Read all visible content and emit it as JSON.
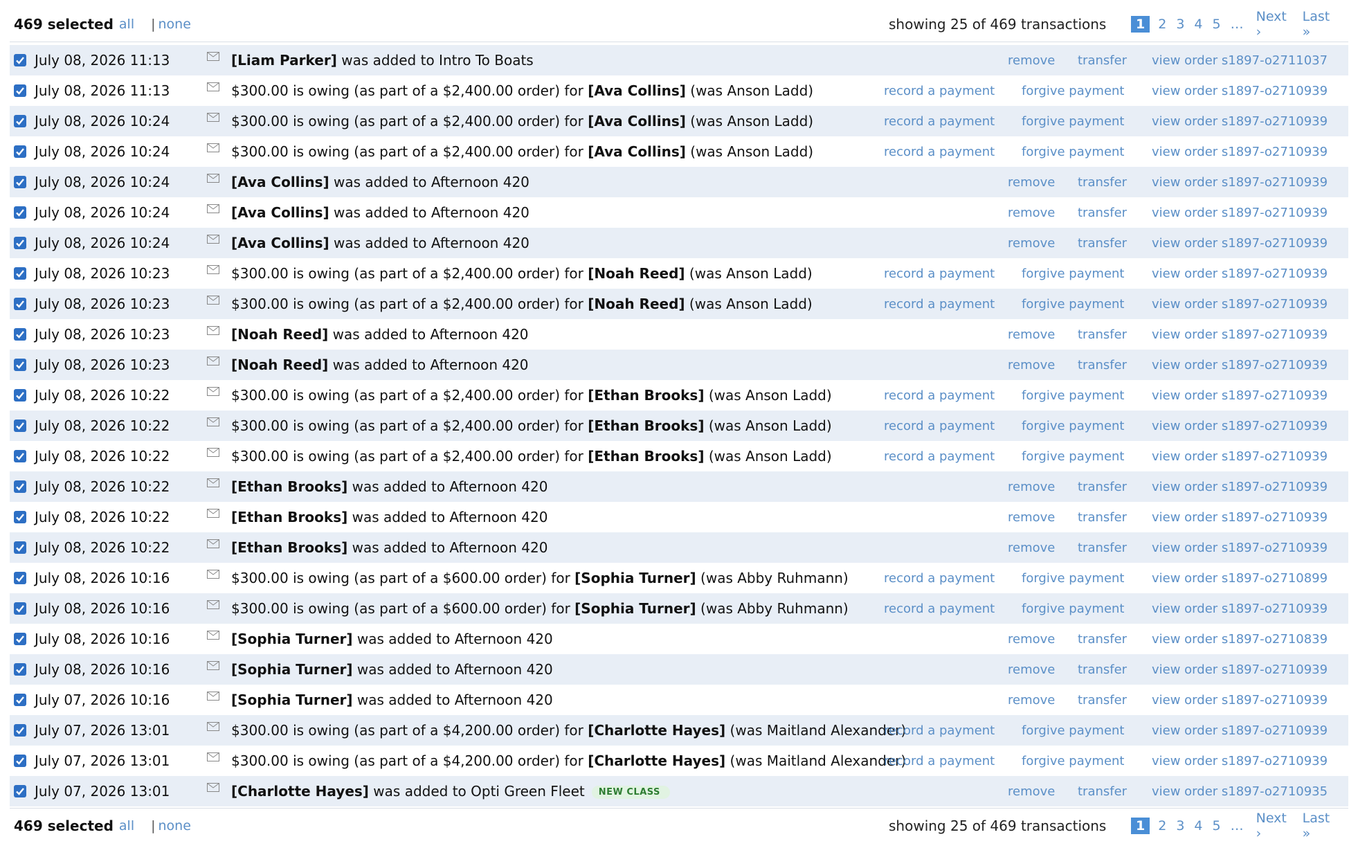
{
  "selection": {
    "count_label": "469 selected",
    "all_label": "all",
    "none_label": "none",
    "separator": "|"
  },
  "showing_label": "showing 25 of 469 transactions",
  "pagination": {
    "pages": [
      "1",
      "2",
      "3",
      "4",
      "5"
    ],
    "current": "1",
    "ellipsis": "…",
    "next_label": "Next ›",
    "last_label": "Last »"
  },
  "accent_color": "#5b8fc7",
  "actions": {
    "remove": "remove",
    "transfer": "transfer",
    "record": "record a payment",
    "forgive": "forgive payment"
  },
  "rows": [
    {
      "date": "July 08, 2026 11:13",
      "type": "added",
      "name": "[Liam Parker]",
      "text": "was added to Intro To Boats",
      "view": "view order s1897-o2711037"
    },
    {
      "date": "July 08, 2026 11:13",
      "type": "owing",
      "prefix": "$300.00 is owing (as part of a $2,400.00 order) for",
      "name": "[Ava Collins]",
      "suffix": "(was Anson Ladd)",
      "view": "view order s1897-o2710939"
    },
    {
      "date": "July 08, 2026 10:24",
      "type": "owing",
      "prefix": "$300.00 is owing (as part of a $2,400.00 order) for",
      "name": "[Ava Collins]",
      "suffix": "(was Anson Ladd)",
      "view": "view order s1897-o2710939"
    },
    {
      "date": "July 08, 2026 10:24",
      "type": "owing",
      "prefix": "$300.00 is owing (as part of a $2,400.00 order) for",
      "name": "[Ava Collins]",
      "suffix": "(was Anson Ladd)",
      "view": "view order s1897-o2710939"
    },
    {
      "date": "July 08, 2026 10:24",
      "type": "added",
      "name": "[Ava Collins]",
      "text": "was added to Afternoon 420",
      "view": "view order s1897-o2710939"
    },
    {
      "date": "July 08, 2026 10:24",
      "type": "added",
      "name": "[Ava Collins]",
      "text": "was added to Afternoon 420",
      "view": "view order s1897-o2710939"
    },
    {
      "date": "July 08, 2026 10:24",
      "type": "added",
      "name": "[Ava Collins]",
      "text": "was added to Afternoon 420",
      "view": "view order s1897-o2710939"
    },
    {
      "date": "July 08, 2026 10:23",
      "type": "owing",
      "prefix": "$300.00 is owing (as part of a $2,400.00 order) for",
      "name": "[Noah Reed]",
      "suffix": "(was Anson Ladd)",
      "view": "view order s1897-o2710939"
    },
    {
      "date": "July 08, 2026 10:23",
      "type": "owing",
      "prefix": "$300.00 is owing (as part of a $2,400.00 order) for",
      "name": "[Noah Reed]",
      "suffix": "(was Anson Ladd)",
      "view": "view order s1897-o2710939"
    },
    {
      "date": "July 08, 2026 10:23",
      "type": "added",
      "name": "[Noah Reed]",
      "text": "was added to Afternoon 420",
      "view": "view order s1897-o2710939"
    },
    {
      "date": "July 08, 2026 10:23",
      "type": "added",
      "name": "[Noah Reed]",
      "text": "was added to Afternoon 420",
      "view": "view order s1897-o2710939"
    },
    {
      "date": "July 08, 2026 10:22",
      "type": "owing",
      "prefix": "$300.00 is owing (as part of a $2,400.00 order) for",
      "name": "[Ethan Brooks]",
      "suffix": "(was Anson Ladd)",
      "view": "view order s1897-o2710939"
    },
    {
      "date": "July 08, 2026 10:22",
      "type": "owing",
      "prefix": "$300.00 is owing (as part of a $2,400.00 order) for",
      "name": "[Ethan Brooks]",
      "suffix": "(was Anson Ladd)",
      "view": "view order s1897-o2710939"
    },
    {
      "date": "July 08, 2026 10:22",
      "type": "owing",
      "prefix": "$300.00 is owing (as part of a $2,400.00 order) for",
      "name": "[Ethan Brooks]",
      "suffix": "(was Anson Ladd)",
      "view": "view order s1897-o2710939"
    },
    {
      "date": "July 08, 2026 10:22",
      "type": "added",
      "name": "[Ethan Brooks]",
      "text": "was added to Afternoon 420",
      "view": "view order s1897-o2710939"
    },
    {
      "date": "July 08, 2026 10:22",
      "type": "added",
      "name": "[Ethan Brooks]",
      "text": "was added to Afternoon 420",
      "view": "view order s1897-o2710939"
    },
    {
      "date": "July 08, 2026 10:22",
      "type": "added",
      "name": "[Ethan Brooks]",
      "text": "was added to Afternoon 420",
      "view": "view order s1897-o2710939"
    },
    {
      "date": "July 08, 2026 10:16",
      "type": "owing",
      "prefix": "$300.00 is owing (as part of a $600.00 order) for",
      "name": "[Sophia Turner]",
      "suffix": "(was Abby Ruhmann)",
      "view": "view order s1897-o2710899"
    },
    {
      "date": "July 08, 2026 10:16",
      "type": "owing",
      "prefix": "$300.00 is owing (as part of a $600.00 order) for",
      "name": "[Sophia Turner]",
      "suffix": "(was Abby Ruhmann)",
      "view": "view order s1897-o2710939"
    },
    {
      "date": "July 08, 2026 10:16",
      "type": "added",
      "name": "[Sophia Turner]",
      "text": "was added to Afternoon 420",
      "view": "view order s1897-o2710839"
    },
    {
      "date": "July 08, 2026 10:16",
      "type": "added",
      "name": "[Sophia Turner]",
      "text": "was added to Afternoon 420",
      "view": "view order s1897-o2710939"
    },
    {
      "date": "July 07, 2026 10:16",
      "type": "added",
      "name": "[Sophia Turner]",
      "text": "was added to Afternoon 420",
      "view": "view order s1897-o2710939"
    },
    {
      "date": "July 07, 2026 13:01",
      "type": "owing",
      "prefix": "$300.00 is owing (as part of a $4,200.00 order) for",
      "name": "[Charlotte Hayes]",
      "suffix": "(was Maitland Alexander)",
      "view": "view order s1897-o2710939"
    },
    {
      "date": "July 07, 2026 13:01",
      "type": "owing",
      "prefix": "$300.00 is owing (as part of a $4,200.00 order) for",
      "name": "[Charlotte Hayes]",
      "suffix": "(was Maitland Alexander)",
      "view": "view order s1897-o2710939"
    },
    {
      "date": "July 07, 2026 13:01",
      "type": "added",
      "name": "[Charlotte Hayes]",
      "text": "was added to Opti Green Fleet",
      "badge": "NEW CLASS",
      "view": "view order s1897-o2710935"
    }
  ]
}
